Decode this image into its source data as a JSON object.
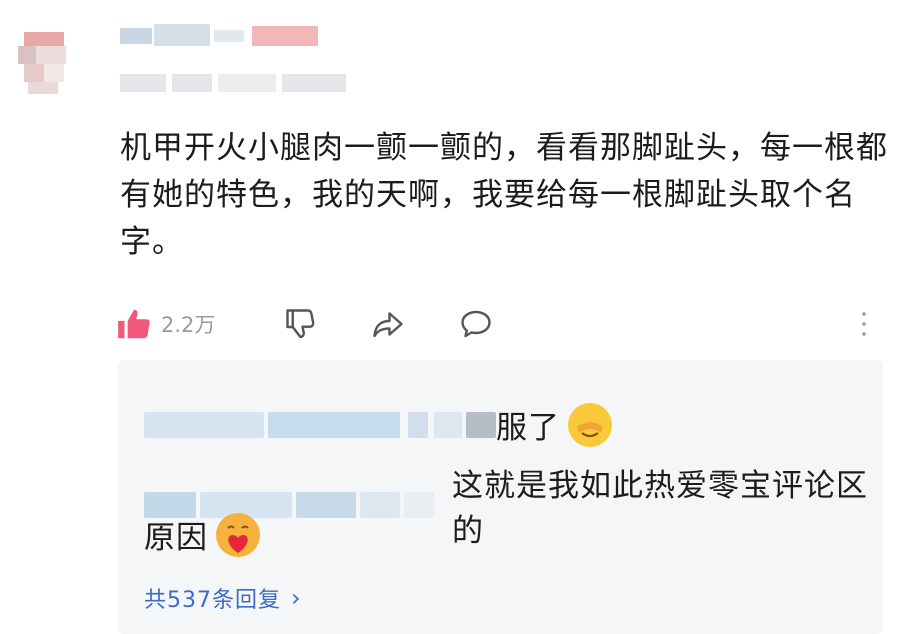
{
  "comment": {
    "text": "机甲开火小腿肉一颤一颤的，看看那脚趾头，每一根都有她的特色，我的天啊，我要给每一根脚趾头取个名字。",
    "like_count": "2.2万"
  },
  "replies": [
    {
      "text": "服了",
      "emoji": "face-with-hand-over-eyes"
    },
    {
      "text": "这就是我如此热爱零宝评论区的",
      "text2": "原因",
      "emoji": "face-holding-heart"
    }
  ],
  "more_replies_label": "共537条回复",
  "more_replies_chevron": "›",
  "colors": {
    "like": "#f0597c",
    "link": "#3a6cc7",
    "reply_bg": "#f4f6f8",
    "muted": "#9a9a9a"
  }
}
